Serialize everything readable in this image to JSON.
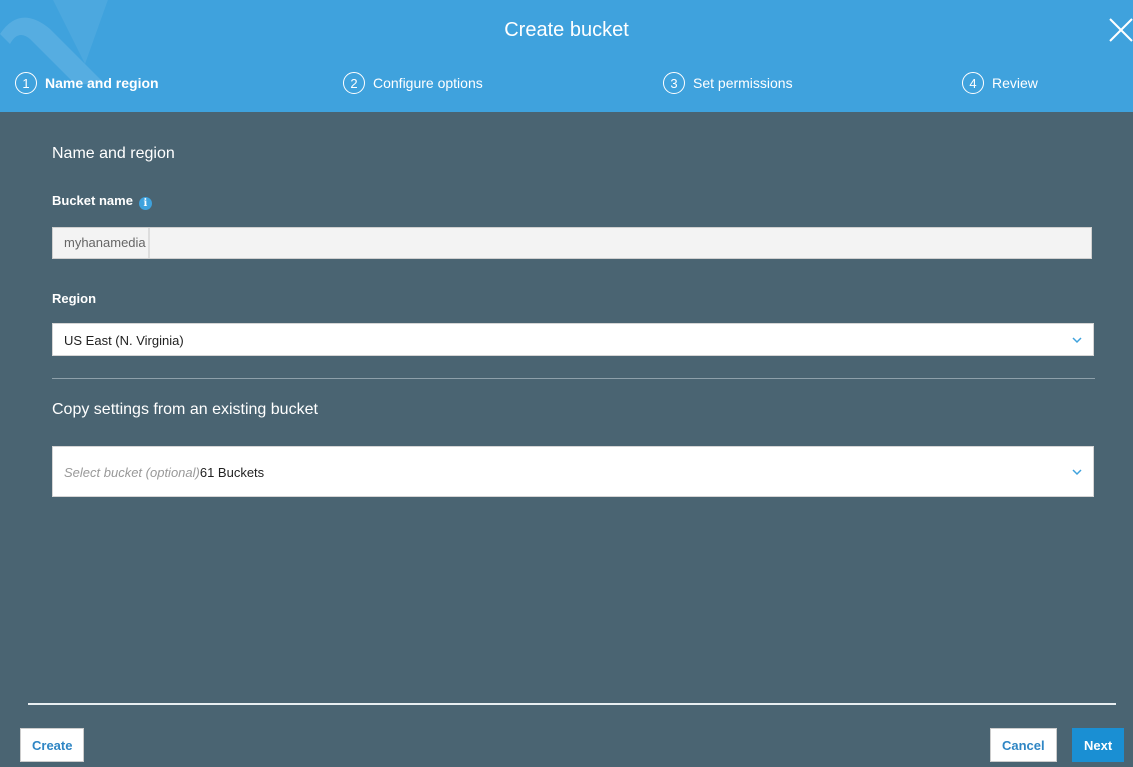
{
  "dialog": {
    "title": "Create bucket"
  },
  "steps": [
    {
      "number": "1",
      "label": "Name and region",
      "active": true
    },
    {
      "number": "2",
      "label": "Configure options",
      "active": false
    },
    {
      "number": "3",
      "label": "Set permissions",
      "active": false
    },
    {
      "number": "4",
      "label": "Review",
      "active": false
    }
  ],
  "form": {
    "section_title": "Name and region",
    "bucket_name_label": "Bucket name",
    "bucket_name_value": "myhanamedia",
    "region_label": "Region",
    "region_value": "US East (N. Virginia)",
    "copy_title": "Copy settings from an existing bucket",
    "copy_placeholder": "Select bucket (optional)",
    "copy_count": "61 Buckets"
  },
  "footer": {
    "create_label": "Create",
    "cancel_label": "Cancel",
    "next_label": "Next"
  },
  "colors": {
    "header": "#3fa2dd",
    "body": "#4a6472",
    "primary_button": "#1a8fd3"
  },
  "icons": {
    "close": "close-icon",
    "info": "info-icon",
    "chevron": "chevron-down-icon"
  }
}
